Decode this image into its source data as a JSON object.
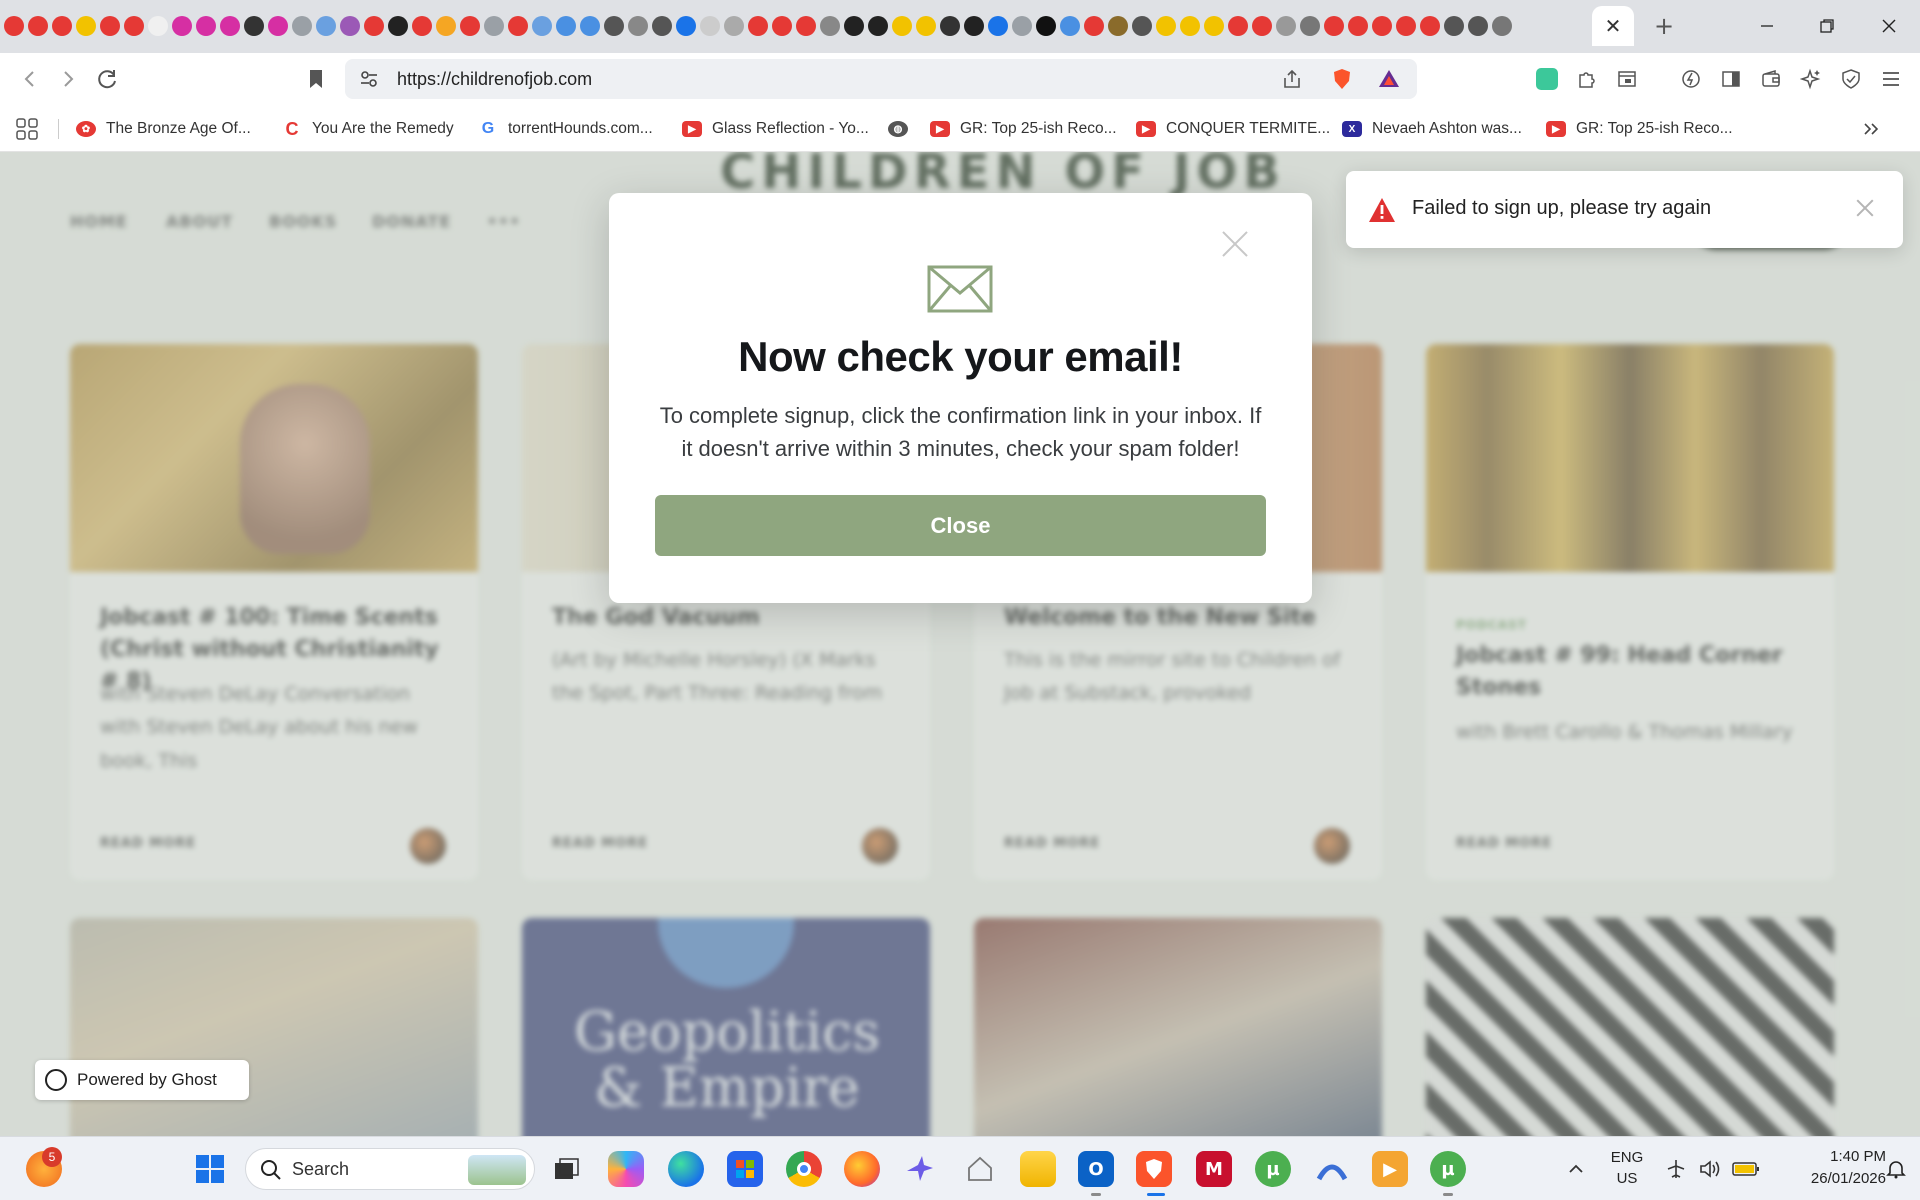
{
  "browser": {
    "active_tab_close": "✕",
    "new_tab": "+",
    "url": "https://childrenofjob.com",
    "bookmarks": [
      {
        "label": "The Bronze Age Of...",
        "color": "#e53935"
      },
      {
        "label": "You Are the Remedy",
        "color": "#e53935"
      },
      {
        "label": "torrentHounds.com...",
        "color": "#4285f4"
      },
      {
        "label": "Glass Reflection - Yo...",
        "color": "#e53935"
      },
      {
        "label": "",
        "color": "#444444"
      },
      {
        "label": "GR: Top 25-ish Reco...",
        "color": "#e53935"
      },
      {
        "label": "CONQUER TERMITE...",
        "color": "#e53935"
      },
      {
        "label": "Nevaeh Ashton was...",
        "color": "#2d2a9c"
      },
      {
        "label": "GR: Top 25-ish Reco...",
        "color": "#e53935"
      }
    ]
  },
  "site": {
    "logo": "CHILDREN OF JOB",
    "nav": [
      "HOME",
      "ABOUT",
      "BOOKS",
      "DONATE",
      "•••"
    ],
    "cards": [
      {
        "title": "Jobcast # 100: Time Scents (Christ without Christianity # 8)",
        "excerpt": "with Steven DeLay Conversation with Steven DeLay about his new book, This",
        "tag": "",
        "read_more": "READ MORE"
      },
      {
        "title": "The God Vacuum",
        "excerpt": "(Art by Michelle Horsley) (X Marks the Spot, Part Three: Reading from",
        "tag": "",
        "read_more": "READ MORE"
      },
      {
        "title": "Welcome to the New Site",
        "excerpt": "This is the mirror site to Children of Job at Substack, provoked",
        "tag": "",
        "read_more": "READ MORE"
      },
      {
        "title": "Jobcast # 99: Head Corner Stones",
        "excerpt": "with Brett Carollo & Thomas Millary",
        "tag": "PODCAST",
        "read_more": "READ MORE"
      }
    ],
    "row2_caption": "Geopolitics & Empire",
    "powered_by": "Powered by Ghost"
  },
  "modal": {
    "title": "Now check your email!",
    "body": "To complete signup, click the confirmation link in your inbox. If it doesn't arrive within 3 minutes, check your spam folder!",
    "close_label": "Close",
    "button_color": "#8fa67f"
  },
  "toast": {
    "message": "Failed to sign up, please try again",
    "icon": "warning-triangle-icon",
    "icon_color": "#e03131"
  },
  "taskbar": {
    "search_placeholder": "Search",
    "notification_count": "5",
    "language": "ENG",
    "region": "US",
    "time": "1:40 PM",
    "date": "26/01/2026"
  }
}
